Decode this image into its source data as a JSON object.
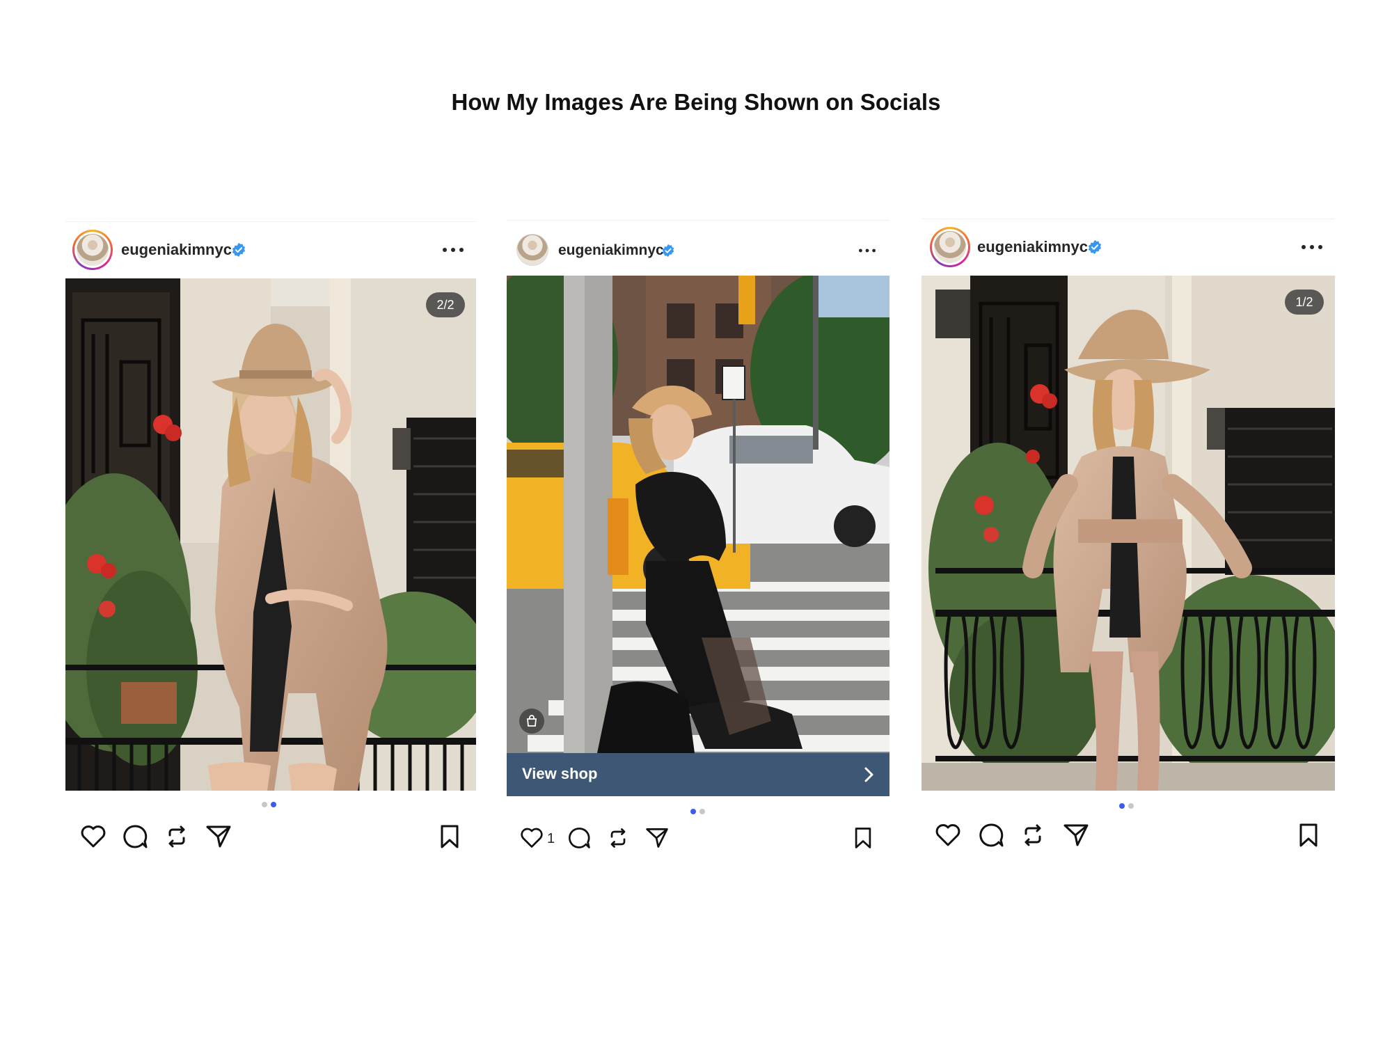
{
  "page": {
    "title": "How My Images Are Being Shown on Socials"
  },
  "posts": [
    {
      "username": "eugeniakimnyc",
      "verified": true,
      "avatar_style": "story-ring",
      "photo_subject": "woman in tan suede belted blazer and tan fedora touching hat brim by black iron railing with red geraniums",
      "carousel_counter": "2/2",
      "carousel_dots": {
        "total": 2,
        "active_index": 1
      },
      "like_count": "",
      "shop_cta": "",
      "icons": [
        "heart-icon",
        "comment-icon",
        "repost-icon",
        "share-icon",
        "bookmark-icon",
        "more-icon",
        "verified-badge-icon"
      ]
    },
    {
      "username": "eugeniakimnyc",
      "verified": true,
      "avatar_style": "plain",
      "photo_subject": "woman in black turtleneck, black skirt, tan cap and black boots leaning on pole at crosswalk with yellow taxi",
      "carousel_counter": "",
      "carousel_dots": {
        "total": 2,
        "active_index": 0
      },
      "like_count": "1",
      "shop_cta": "View shop",
      "icons": [
        "heart-icon",
        "comment-icon",
        "repost-icon",
        "share-icon",
        "bookmark-icon",
        "more-icon",
        "verified-badge-icon",
        "shopping-bag-icon",
        "chevron-right-icon"
      ]
    },
    {
      "username": "eugeniakimnyc",
      "verified": true,
      "avatar_style": "story-ring",
      "photo_subject": "woman in tan suede belted blazer and tan fedora standing against black iron railing with red flowers",
      "carousel_counter": "1/2",
      "carousel_dots": {
        "total": 2,
        "active_index": 0
      },
      "like_count": "",
      "shop_cta": "",
      "icons": [
        "heart-icon",
        "comment-icon",
        "repost-icon",
        "share-icon",
        "bookmark-icon",
        "more-icon",
        "verified-badge-icon"
      ]
    }
  ],
  "colors": {
    "verified_blue": "#3897f0",
    "dot_active": "#3b5cf0",
    "dot_inactive": "#c7c7c7",
    "shop_bar": "#3e5774"
  }
}
